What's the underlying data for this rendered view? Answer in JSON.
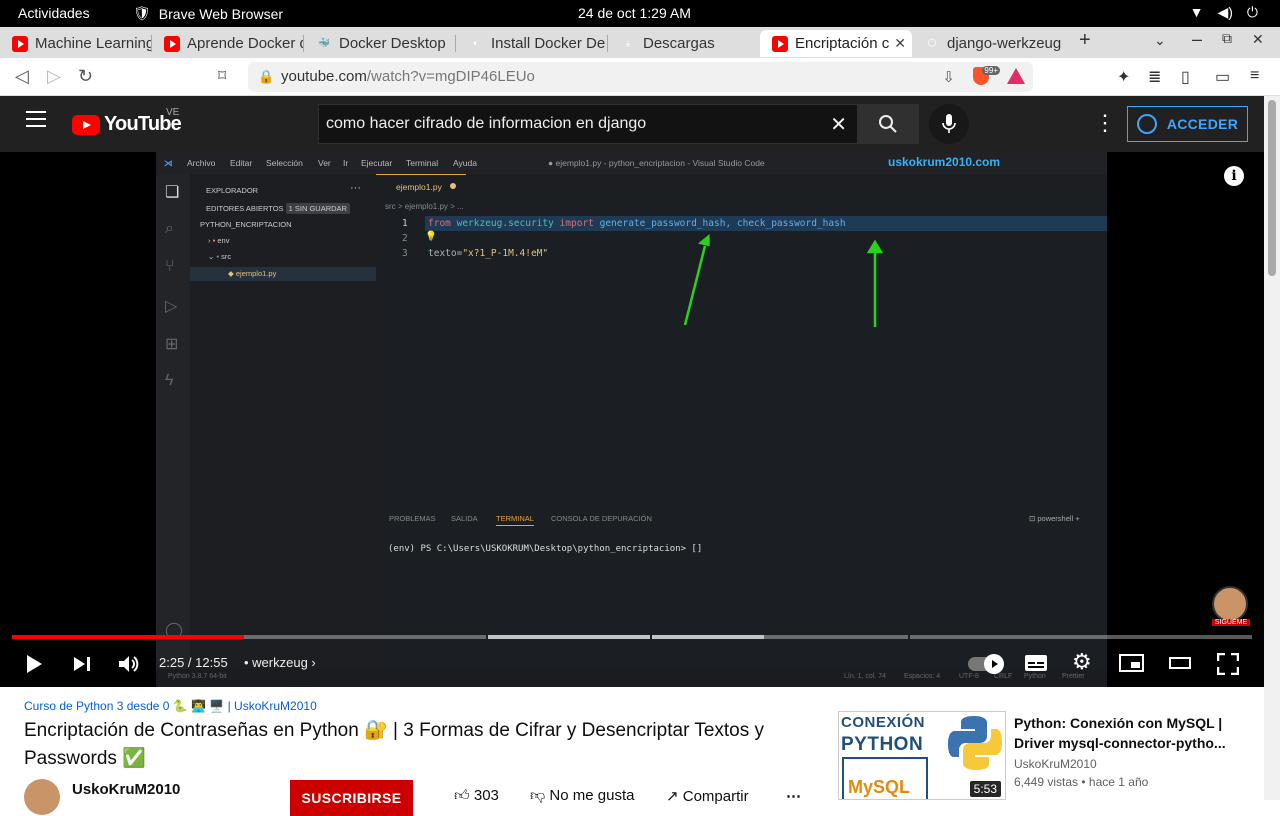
{
  "system": {
    "activities": "Actividades",
    "app_name": "Brave Web Browser",
    "clock": "24 de oct   1:29 AM",
    "tray": [
      "▼",
      "◀)",
      "⏻"
    ]
  },
  "tabs": [
    {
      "title": "Machine Learning",
      "favicon": "youtube-icon"
    },
    {
      "title": "Aprende Docker d",
      "favicon": "youtube-icon"
    },
    {
      "title": "Docker Desktop",
      "favicon": "docker-icon"
    },
    {
      "title": "Install Docker De",
      "favicon": "site-icon"
    },
    {
      "title": "Descargas",
      "favicon": "download-icon"
    },
    {
      "title": "Encriptación c",
      "favicon": "youtube-icon",
      "active": true
    },
    {
      "title": "django-werkzeug",
      "favicon": "cube-icon"
    }
  ],
  "address": {
    "host": "youtube.com",
    "path": "/watch?v=mgDIP46LEUo",
    "brave_badge": "99+"
  },
  "youtube": {
    "logo_text": "YouTube",
    "country": "VE",
    "search_query": "como hacer cifrado de informacion en django",
    "signin_label": "ACCEDER"
  },
  "video_frame": {
    "menu": [
      "Archivo",
      "Editar",
      "Selección",
      "Ver",
      "Ir",
      "Ejecutar",
      "Terminal",
      "Ayuda"
    ],
    "window_title": "● ejemplo1.py - python_encriptacion - Visual Studio Code",
    "watermark": "uskokrum2010.com",
    "explorer_title": "EXPLORADOR",
    "open_editors": "EDITORES ABIERTOS",
    "unsaved": "1 SIN GUARDAR",
    "project": "PYTHON_ENCRIPTACION",
    "folder_env": "env",
    "folder_src": "src",
    "file": "ejemplo1.py",
    "tab_file": "ejemplo1.py",
    "breadcrumb": "src > ejemplo1.py > ...",
    "code": {
      "l1_from": "from",
      "l1_mod": " werkzeug.security ",
      "l1_import": "import",
      "l1_names": " generate_password_hash, check_password_hash",
      "l3_var": "texto=",
      "l3_str": "\"x?1_P-1M.4!eM\""
    },
    "panel_tabs": [
      "PROBLEMAS",
      "SALIDA",
      "TERMINAL",
      "CONSOLA DE DEPURACIÓN"
    ],
    "shell": "powershell",
    "terminal_line": "(env) PS C:\\Users\\USKOKRUM\\Desktop\\python_encriptacion> []",
    "status": [
      "Python 3.8.7 64-bit",
      "Lín. 1, col. 74",
      "Espacios: 4",
      "UTF-8",
      "CRLF",
      "Python",
      "Prettier"
    ],
    "sigueme": "SIGUEME"
  },
  "player": {
    "current_time": "2:25",
    "duration": "12:55",
    "chapter": "• werkzeug",
    "progress_fraction": 0.1873
  },
  "watch": {
    "playlist": "Curso de Python 3 desde 0 🐍 👨‍💻 🖥️ | UskoKruM2010",
    "title": "Encriptación de Contraseñas en Python 🔐 | 3 Formas de Cifrar y Desencriptar Textos y Passwords ✅",
    "channel": "UskoKruM2010",
    "subscribe": "SUSCRIBIRSE",
    "likes": "303",
    "dislike": "No me gusta",
    "share": "Compartir"
  },
  "related": {
    "thumb_line1": "CONEXIÓN",
    "thumb_line2": "PYTHON",
    "thumb_mysql": "MySQL",
    "duration": "5:53",
    "title": "Python: Conexión con MySQL | Driver mysql-connector-pytho...",
    "channel": "UskoKruM2010",
    "meta": "6,449 vistas • hace 1 año"
  }
}
